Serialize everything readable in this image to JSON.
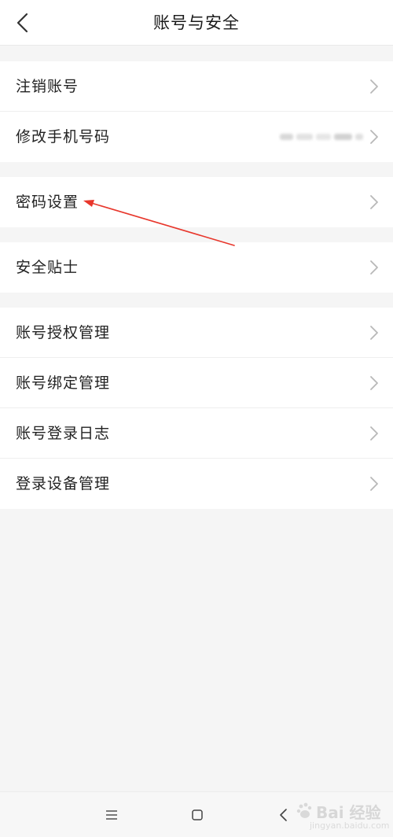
{
  "header": {
    "title": "账号与安全",
    "back_icon": "chevron-left-icon"
  },
  "groups": [
    {
      "items": [
        {
          "label": "注销账号",
          "icon": "chevron-right-icon"
        },
        {
          "label": "修改手机号码",
          "icon": "chevron-right-icon"
        }
      ]
    },
    {
      "items": [
        {
          "label": "密码设置",
          "icon": "chevron-right-icon"
        }
      ]
    },
    {
      "items": [
        {
          "label": "安全贴士",
          "icon": "chevron-right-icon"
        }
      ]
    },
    {
      "items": [
        {
          "label": "账号授权管理",
          "icon": "chevron-right-icon"
        },
        {
          "label": "账号绑定管理",
          "icon": "chevron-right-icon"
        },
        {
          "label": "账号登录日志",
          "icon": "chevron-right-icon"
        },
        {
          "label": "登录设备管理",
          "icon": "chevron-right-icon"
        }
      ]
    }
  ],
  "annotation": {
    "color": "#e8372c"
  },
  "navbar": {
    "menu_icon": "menu-icon",
    "home_icon": "home-square-icon",
    "back_icon": "back-triangle-icon"
  },
  "watermark": {
    "brand": "Bai 经验",
    "sub": "jingyan.baidu.com"
  },
  "colors": {
    "background": "#f5f5f5",
    "surface": "#ffffff",
    "text": "#222222",
    "chevron": "#b8b8b8",
    "divider": "#eeeeee"
  }
}
